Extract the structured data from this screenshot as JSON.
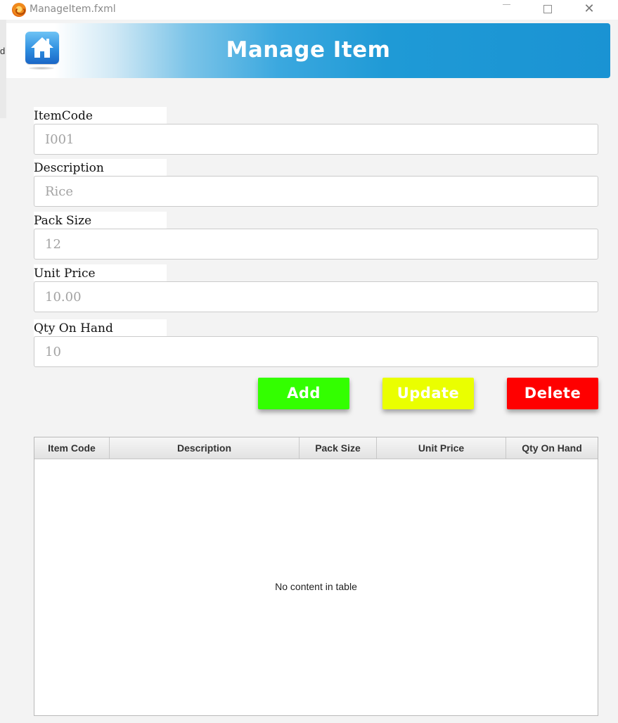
{
  "window": {
    "title": "ManageItem.fxml",
    "left_strip_char": "d"
  },
  "banner": {
    "title": "Manage Item",
    "icon": "home-icon"
  },
  "form": {
    "item_code": {
      "label": "ItemCode",
      "placeholder": "I001"
    },
    "description": {
      "label": "Description",
      "placeholder": "Rice"
    },
    "pack_size": {
      "label": "Pack Size",
      "placeholder": "12"
    },
    "unit_price": {
      "label": "Unit Price",
      "placeholder": "10.00"
    },
    "qty_on_hand": {
      "label": "Qty On Hand",
      "placeholder": "10"
    }
  },
  "buttons": {
    "add": "Add",
    "update": "Update",
    "delete": "Delete"
  },
  "table": {
    "columns": [
      "Item Code",
      "Description",
      "Pack Size",
      "Unit Price",
      "Qty On Hand"
    ],
    "rows": [],
    "empty_message": "No content in table"
  },
  "colors": {
    "add": "#33ff00",
    "update": "#eaff00",
    "delete": "#ff0000",
    "banner": "#1a93d3"
  }
}
